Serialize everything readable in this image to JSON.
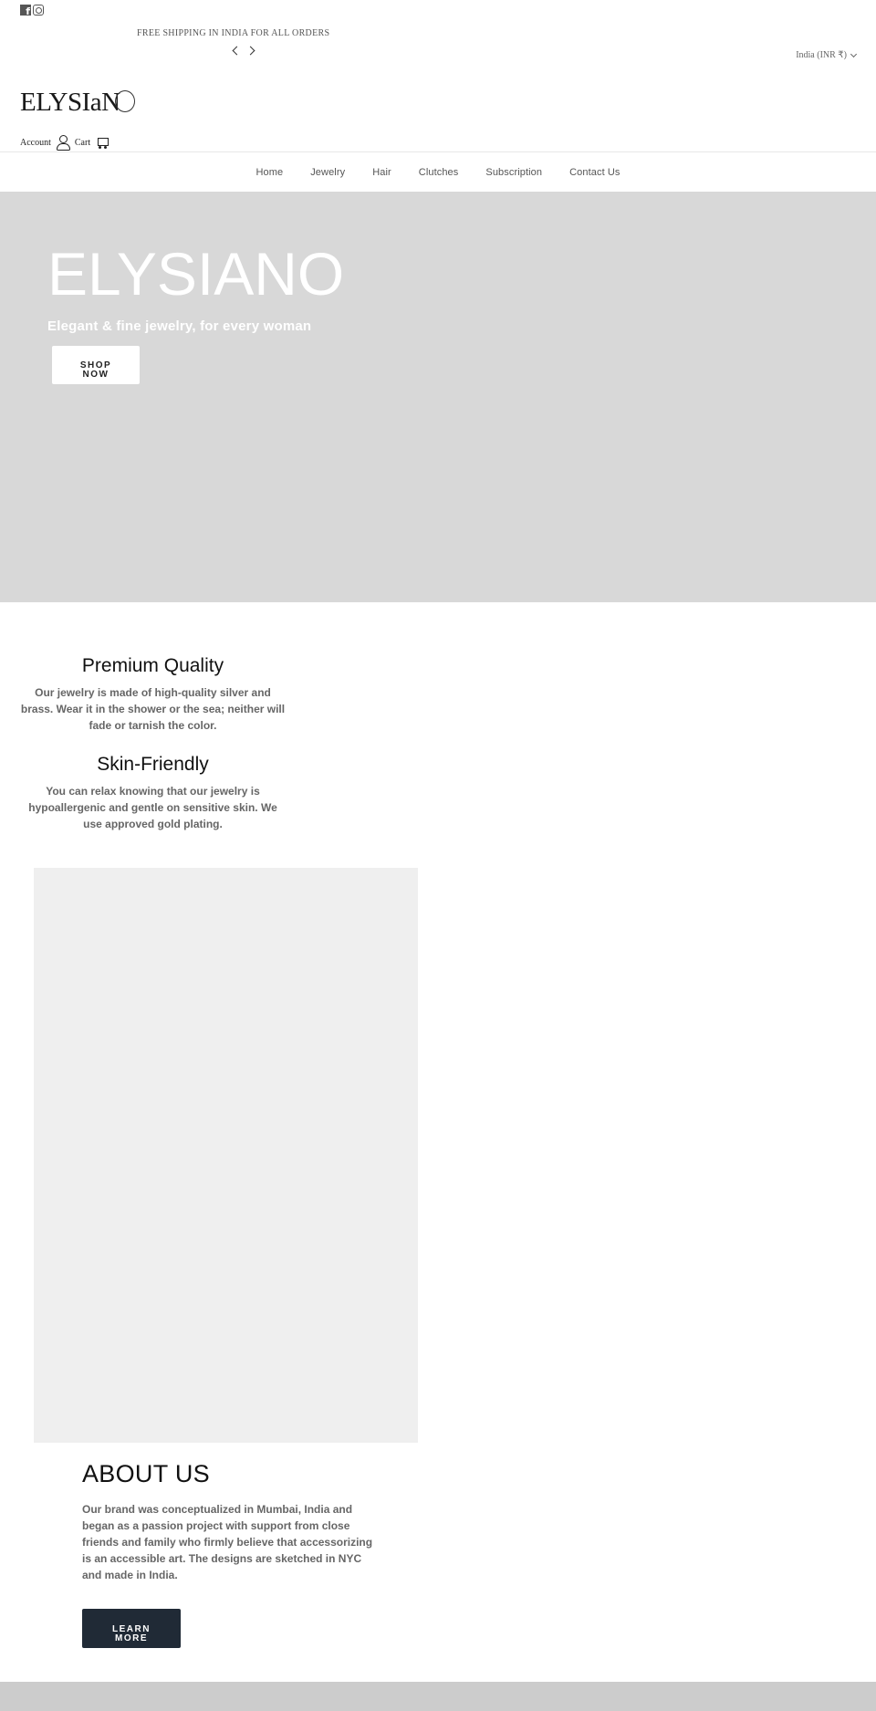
{
  "social": {
    "icons": [
      "facebook-icon",
      "instagram-icon"
    ]
  },
  "announcement": {
    "text": "FREE SHIPPING IN INDIA FOR ALL ORDERS",
    "prev_icon": "chevron-left-icon",
    "next_icon": "chevron-right-icon"
  },
  "currency": {
    "selected": "India (INR ₹)",
    "icon": "chevron-down-icon"
  },
  "header": {
    "logo_text": "ELYSIaN",
    "account_label": "Account",
    "cart_label": "Cart"
  },
  "nav": {
    "items": [
      {
        "label": "Home"
      },
      {
        "label": "Jewelry"
      },
      {
        "label": "Hair"
      },
      {
        "label": "Clutches"
      },
      {
        "label": "Subscription"
      },
      {
        "label": "Contact Us"
      }
    ]
  },
  "hero": {
    "title": "ELYSIANO",
    "subtitle": "Elegant & fine jewelry, for every woman",
    "button_line1": "SHOP",
    "button_line2": "NOW",
    "background_color": "#d8d8d8"
  },
  "features": [
    {
      "title": "Premium Quality",
      "text": "Our jewelry is made of high-quality silver and brass. Wear it in the shower or the sea; neither will fade or tarnish the color."
    },
    {
      "title": "Skin-Friendly",
      "text": "You can relax knowing that our jewelry is hypoallergenic and gentle on sensitive skin. We use approved gold plating."
    }
  ],
  "about": {
    "title": "ABOUT US",
    "text": "Our brand was conceptualized in Mumbai, India and began as a passion project with support from close friends and family who firmly believe that accessorizing is an accessible art.  The designs are sketched in NYC and made in India.",
    "button_line1": "LEARN",
    "button_line2": "MORE",
    "button_color": "#202a36"
  }
}
